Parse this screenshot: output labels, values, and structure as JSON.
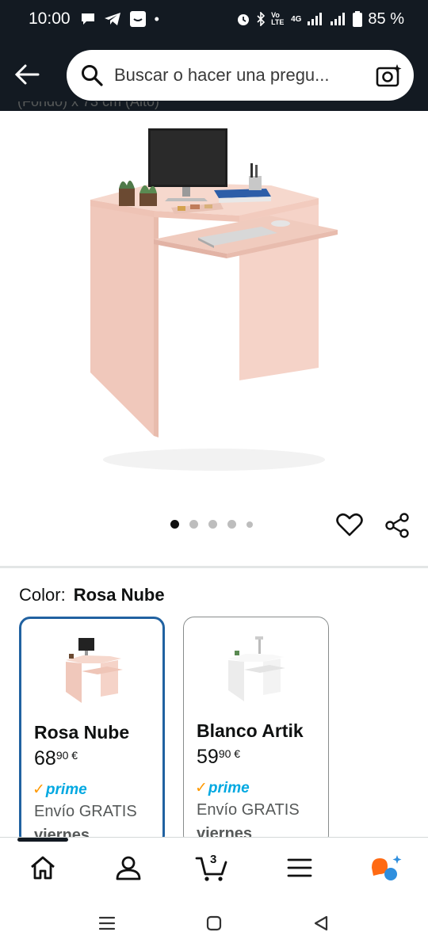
{
  "status_bar": {
    "time": "10:00",
    "battery": "85 %",
    "network": "4G",
    "volte": "Vo LTE"
  },
  "header": {
    "search_placeholder": "Buscar o hacer una pregu..."
  },
  "product": {
    "cut_off_text": "(Fondo) x 73 cm (Alto)",
    "image_count": 5,
    "active_image": 1
  },
  "color_selector": {
    "label": "Color:",
    "selected": "Rosa Nube",
    "options": [
      {
        "name": "Rosa Nube",
        "price_int": "68",
        "price_dec": "90",
        "currency": "€",
        "prime": "prime",
        "shipping": "Envío GRATIS",
        "day": "viernes"
      },
      {
        "name": "Blanco Artik",
        "price_int": "59",
        "price_dec": "90",
        "currency": "€",
        "prime": "prime",
        "shipping": "Envío GRATIS",
        "day": "viernes"
      }
    ]
  },
  "bottom_nav": {
    "cart_count": "3",
    "items": [
      "home-icon",
      "account-icon",
      "cart-icon",
      "menu-icon",
      "rufus-icon"
    ]
  },
  "colors": {
    "header_bg": "#131a22",
    "selected_border": "#2162a1",
    "prime_blue": "#00a8e1",
    "prime_check": "#ff9900",
    "desk_pink": "#f4d0c4"
  }
}
